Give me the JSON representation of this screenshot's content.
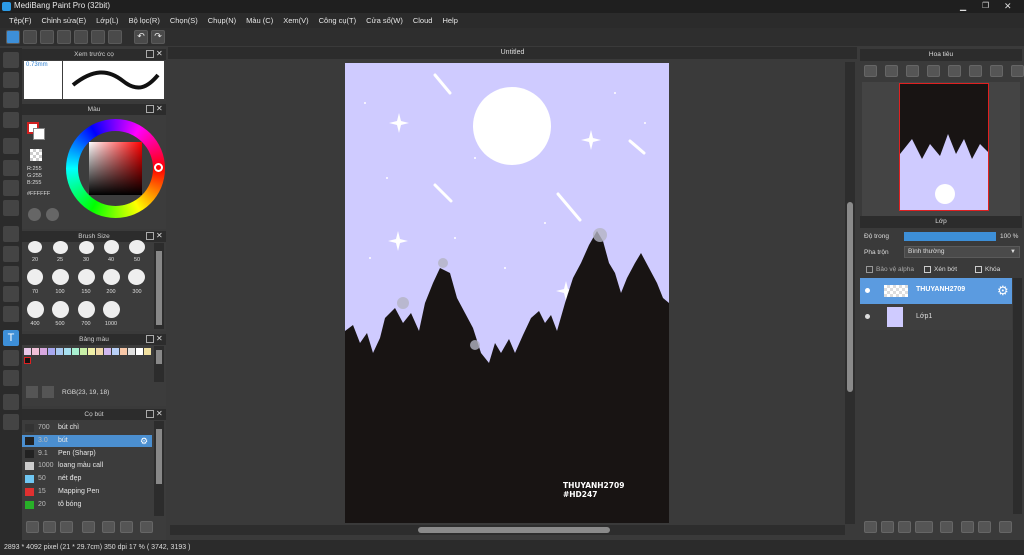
{
  "app": {
    "title": "MediBang Paint Pro (32bit)"
  },
  "menu": [
    "Tệp(F)",
    "Chỉnh sửa(E)",
    "Lớp(L)",
    "Bộ lọc(R)",
    "Chọn(S)",
    "Chụp(N)",
    "Màu (C)",
    "Xem(V)",
    "Công cụ(T)",
    "Cửa sổ(W)",
    "Cloud",
    "Help"
  ],
  "document": {
    "tab": "Untitled",
    "watermark_line1": "THUYANH2709",
    "watermark_line2": "#HD247"
  },
  "panels": {
    "preview": {
      "title": "Xem trước cọ",
      "size": "0.73mm"
    },
    "color": {
      "title": "Màu",
      "r": "R:255",
      "g": "G:255",
      "b": "B:255",
      "hex": "#FFFFFF"
    },
    "brush_size": {
      "title": "Brush Size",
      "sizes": [
        "20",
        "25",
        "30",
        "40",
        "50",
        "70",
        "100",
        "150",
        "200",
        "300",
        "400",
        "500",
        "700",
        "1000"
      ]
    },
    "palette": {
      "title": "Bảng màu",
      "rgb": "RGB(23, 19, 18)",
      "swatches": [
        "#e8c8e8",
        "#f0c0d8",
        "#d8a8e0",
        "#a8a8f0",
        "#a8c8f0",
        "#a8e0f0",
        "#a8f0d0",
        "#c8f0a8",
        "#f0f0a8",
        "#f0d8a8",
        "#d0b8f0",
        "#b8d0f8",
        "#f8c8a8",
        "#e0e0e0",
        "#ffffff",
        "#f0e0a0"
      ]
    },
    "brushes": {
      "title": "Cọ bút",
      "items": [
        {
          "size": "700",
          "name": "bút chì",
          "color": "#333333",
          "selected": false
        },
        {
          "size": "3.0",
          "name": "bút",
          "color": "#222222",
          "selected": true
        },
        {
          "size": "9.1",
          "name": "Pen (Sharp)",
          "color": "#222222",
          "selected": false
        },
        {
          "size": "1000",
          "name": "loang màu call",
          "color": "#cccccc",
          "selected": false
        },
        {
          "size": "50",
          "name": "nét đẹp",
          "color": "#6fc7f3",
          "selected": false
        },
        {
          "size": "15",
          "name": "Mapping Pen",
          "color": "#e03030",
          "selected": false
        },
        {
          "size": "20",
          "name": "tô bóng",
          "color": "#28b028",
          "selected": false
        }
      ]
    },
    "navigator": {
      "title": "Hoa tiêu"
    },
    "layers": {
      "title": "Lớp",
      "opacity_label": "Độ trong",
      "opacity_value": "100 %",
      "blend_label": "Pha trộn",
      "blend_value": "Bình thường",
      "protect_alpha": "Bảo vệ alpha",
      "clipping": "Xén bớt",
      "lock": "Khóa",
      "items": [
        {
          "name": "THUYANH2709",
          "selected": true
        },
        {
          "name": "Lớp1",
          "selected": false
        }
      ]
    }
  },
  "status": {
    "text": "2893 * 4092 pixel   (21 * 29.7cm)   350 dpi   17 %   ( 3742, 3193 )"
  }
}
